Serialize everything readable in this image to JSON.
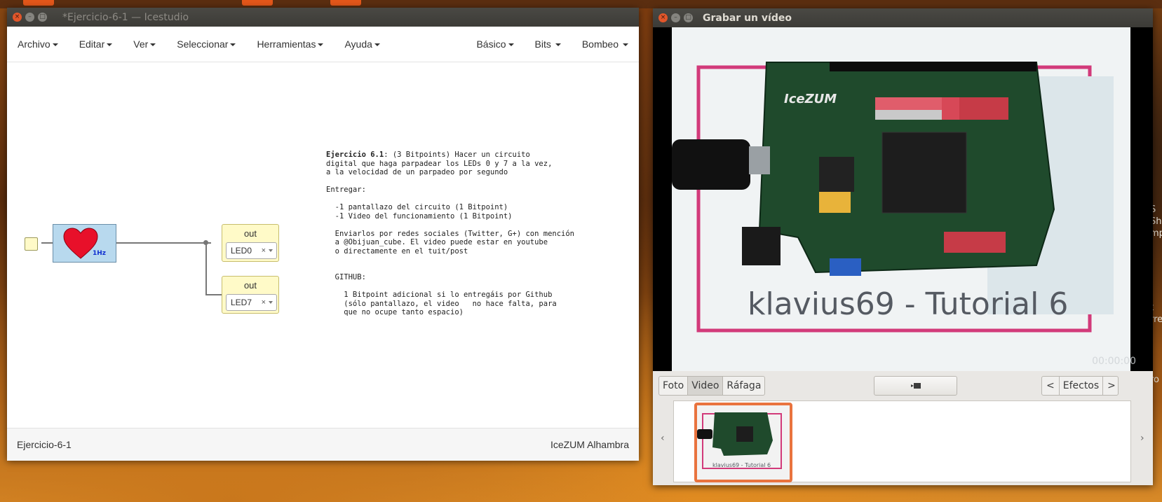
{
  "colors": {
    "accent_orange": "#e9733e",
    "heart": "#e8102a",
    "wire": "#777777",
    "block_blue": "#b8d9ee",
    "block_yellow": "#fffac8"
  },
  "icestudio": {
    "title": "*Ejercicio-6-1 — Icestudio",
    "menus_left": [
      "Archivo",
      "Editar",
      "Ver",
      "Seleccionar",
      "Herramientas",
      "Ayuda"
    ],
    "menus_right": [
      "Básico",
      "Bits",
      "Bombeo"
    ],
    "clock_label": "1Hz",
    "outputs": [
      {
        "label": "out",
        "value": "LED0",
        "clear": "×"
      },
      {
        "label": "out",
        "value": "LED7",
        "clear": "×"
      }
    ],
    "note": {
      "title": "Ejercicio 6.1",
      "l1": ": (3 Bitpoints) Hacer un circuito",
      "l2": "digital que haga parpadear los LEDs 0 y 7 a la vez,",
      "l3": "a la velocidad de un parpadeo por segundo",
      "l4": "Entregar:",
      "l5": "  -1 pantallazo del circuito (1 Bitpoint)",
      "l6": "  -1 Video del funcionamiento (1 Bitpoint)",
      "l7": "  Enviarlos por redes sociales (Twitter, G+) con mención",
      "l8": "  a @Obijuan_cube. El video puede estar en youtube",
      "l9": "  o directamente en el tuit/post",
      "l10": "  GITHUB:",
      "l11": "    1 Bitpoint adicional si lo entregáis por Github",
      "l12": "    (sólo pantallazo, el video   no hace falta, para",
      "l13": "    que no ocupe tanto espacio)"
    },
    "status_left": "Ejercicio-6-1",
    "status_right": "IceZUM Alhambra"
  },
  "cheese": {
    "title": "Grabar un vídeo",
    "video_caption": "klavius69 - Tutorial 6",
    "board_label": "IceZUM",
    "timer": "00:00:00",
    "modes": [
      "Foto",
      "Video",
      "Ráfaga"
    ],
    "active_mode": "Video",
    "effects_label": "Efectos",
    "thumb_caption": "klavius69 - Tutorial 6",
    "nav_prev": "‹",
    "nav_next": "›",
    "btn_prev": "<",
    "btn_next": ">"
  },
  "desktop_edge_text": [
    "S",
    "Sh",
    "mp",
    "t",
    "rre",
    "ro"
  ]
}
